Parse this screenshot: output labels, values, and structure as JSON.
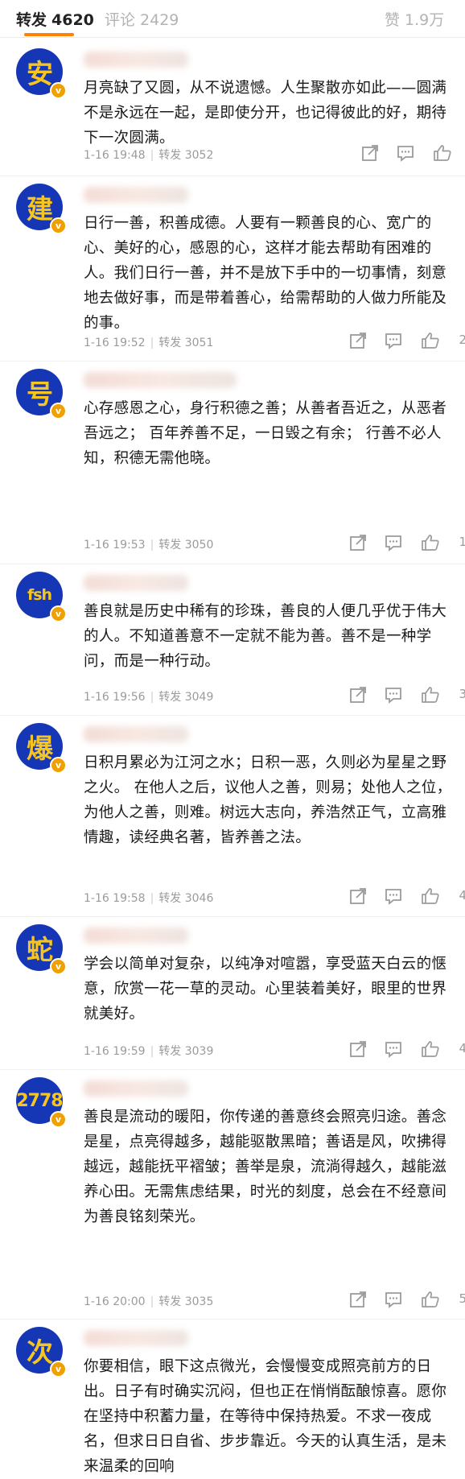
{
  "tabs": [
    {
      "label": "转发",
      "count": "4620"
    },
    {
      "label": "评论",
      "count": "2429"
    },
    {
      "label": "赞",
      "count": "1.9万"
    }
  ],
  "comments": [
    {
      "avatar": "安",
      "text": "月亮缺了又圆，从不说遗憾。人生聚散亦如此——圆满不是永远在一起，是即使分开，也记得彼此的好，期待下一次圆满。",
      "time": "1-16 19:48",
      "repost": "转发 3052",
      "likes": ""
    },
    {
      "avatar": "建",
      "text": "日行一善，积善成德。人要有一颗善良的心、宽广的心、美好的心，感恩的心，这样才能去帮助有困难的人。我们日行一善，并不是放下手中的一切事情，刻意地去做好事，而是带着善心，给需帮助的人做力所能及的事。",
      "time": "1-16 19:52",
      "repost": "转发 3051",
      "likes": "2"
    },
    {
      "avatar": "号",
      "text": "心存感恩之心，身行积德之善；从善者吾近之，从恶者吾远之； 百年养善不足，一日毁之有余； 行善不必人知，积德无需他晓。",
      "time": "1-16 19:53",
      "repost": "转发 3050",
      "likes": "1"
    },
    {
      "avatar": "fsh",
      "text": "善良就是历史中稀有的珍珠，善良的人便几乎优于伟大的人。不知道善意不一定就不能为善。善不是一种学问，而是一种行动。",
      "time": "1-16 19:56",
      "repost": "转发 3049",
      "likes": "3"
    },
    {
      "avatar": "爆",
      "text": "日积月累必为江河之水；日积一恶，久则必为星星之野之火。 在他人之后，议他人之善，则易；处他人之位，为他人之善，则难。树远大志向，养浩然正气，立高雅情趣，读经典名著，皆养善之法。",
      "time": "1-16 19:58",
      "repost": "转发 3046",
      "likes": "4"
    },
    {
      "avatar": "蛇",
      "text": "学会以简单对复杂，以纯净对喧嚣，享受蓝天白云的惬意，欣赏一花一草的灵动。心里装着美好，眼里的世界就美好。",
      "time": "1-16 19:59",
      "repost": "转发 3039",
      "likes": "4"
    },
    {
      "avatar": "2778",
      "text": "善良是流动的暖阳，你传递的善意终会照亮归途。善念是星，点亮得越多，越能驱散黑暗；善语是风，吹拂得越远，越能抚平褶皱；善举是泉，流淌得越久，越能滋养心田。无需焦虑结果，时光的刻度，总会在不经意间为善良铭刻荣光。",
      "time": "1-16 20:00",
      "repost": "转发 3035",
      "likes": "5"
    },
    {
      "avatar": "次",
      "text": "你要相信，眼下这点微光，会慢慢变成照亮前方的日出。日子有时确实沉闷，但也正在悄悄酝酿惊喜。愿你在坚持中积蓄力量，在等待中保持热爱。不求一夜成名，但求日日自省、步步靠近。今天的认真生活，是未来温柔的回响",
      "time": "",
      "repost": "",
      "likes": ""
    }
  ]
}
